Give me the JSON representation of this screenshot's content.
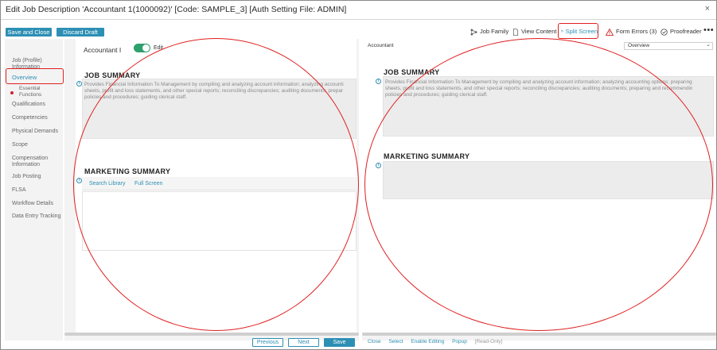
{
  "window": {
    "title": "Edit Job Description 'Accountant 1(1000092)'  [Code: SAMPLE_3] [Auth Setting File: ADMIN]",
    "close": "×"
  },
  "toolbar": {
    "save_close": "Save and Close",
    "discard": "Discard Draft",
    "job_family": "Job Family",
    "view_content": "View Content",
    "split_screen": "Split Screen",
    "form_errors": "Form Errors (3)",
    "proofreader": "Proofreader",
    "more": "•••"
  },
  "sidebar": {
    "items": [
      {
        "label": "Job (Profile) Information"
      },
      {
        "label": "Overview"
      },
      {
        "label": "Essential Functions"
      },
      {
        "label": "Qualifications"
      },
      {
        "label": "Competencies"
      },
      {
        "label": "Physical Demands"
      },
      {
        "label": "Scope"
      },
      {
        "label": "Compensation Information"
      },
      {
        "label": "Job Posting"
      },
      {
        "label": "FLSA"
      },
      {
        "label": "Workflow Details"
      },
      {
        "label": "Data Entry Tracking"
      }
    ]
  },
  "left": {
    "job_title": "Accountant I",
    "edit_label": "Edit",
    "job_summary_title": "JOB SUMMARY",
    "job_summary_lines": [
      "Provides Financial Information To Management by compiling and analyzing account information; analyzing accounti",
      "sheets, profit and loss statements, and other special reports; reconciling discrepancies; auditing documents; prepar",
      "policies and procedures; guiding clerical staff."
    ],
    "marketing_title": "MARKETING SUMMARY",
    "search_library": "Search Library",
    "full_screen": "Full Screen"
  },
  "right": {
    "label": "Accountant",
    "dropdown_value": "Overview",
    "job_summary_title": "JOB SUMMARY",
    "job_summary_lines": [
      "Provides Financial Information To Management by compiling and analyzing account information; analyzing accounting options; preparing",
      "sheets, profit and loss statements, and other special reports; reconciling discrepancies; auditing documents; preparing and recommendin",
      "policies and procedures; guiding clerical staff."
    ],
    "marketing_title": "MARKETING SUMMARY"
  },
  "footer": {
    "previous": "Previous",
    "next": "Next",
    "save": "Save",
    "links": {
      "close": "Close",
      "select": "Select",
      "enable_editing": "Enable Editing",
      "popup": "Popup",
      "read_only": "[Read-Only]"
    }
  },
  "colors": {
    "accent": "#2d8fb4",
    "toggle_on": "#2da06b",
    "annotation": "#e02020"
  }
}
